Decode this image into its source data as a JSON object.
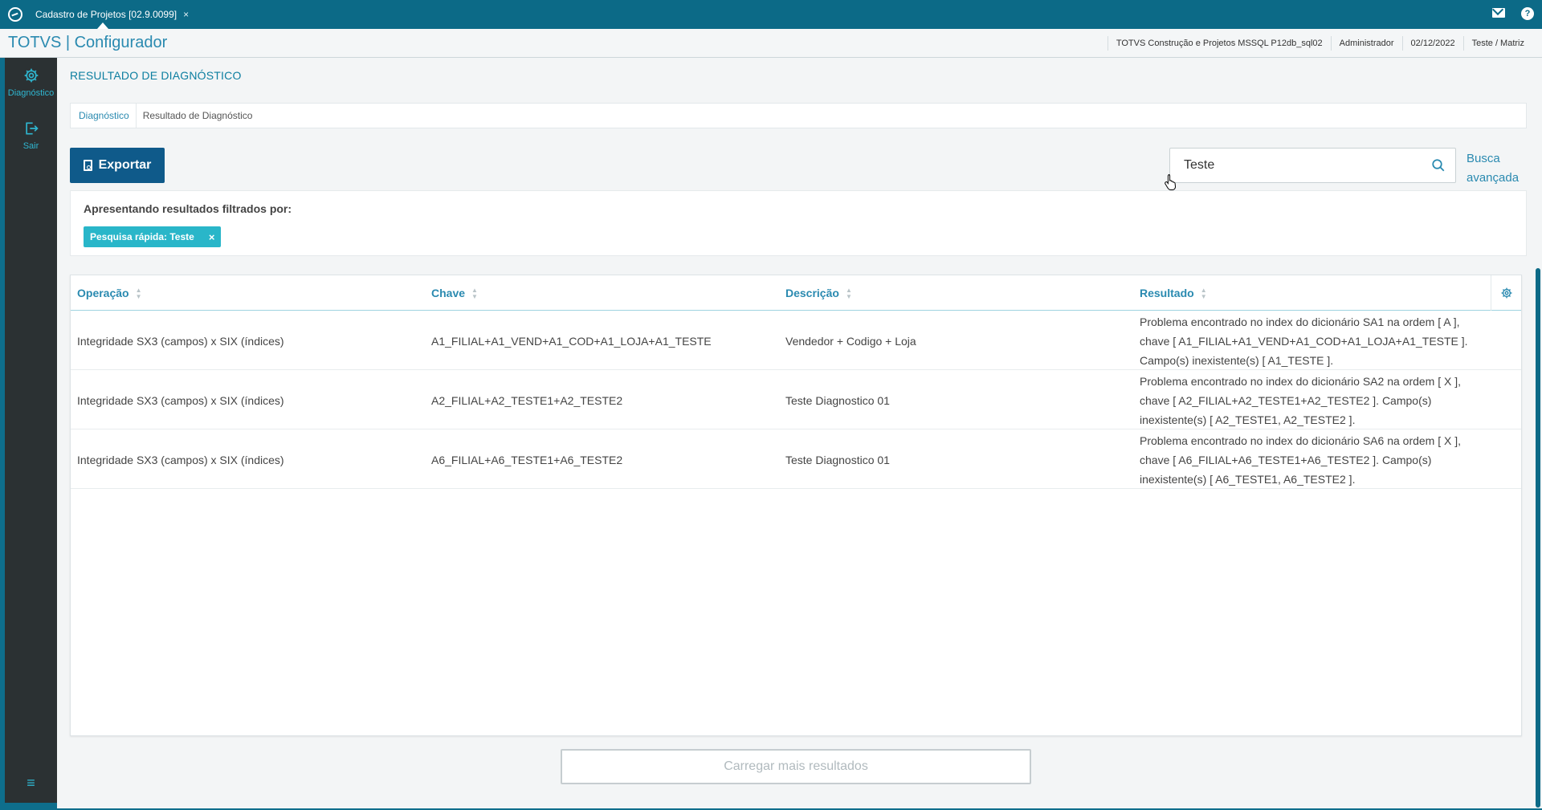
{
  "window": {
    "tab_title": "Cadastro de Projetos [02.9.0099]",
    "tab_close": "×",
    "help_symbol": "?"
  },
  "header": {
    "brand": "TOTVS | Configurador",
    "environment": "TOTVS Construção e Projetos MSSQL P12db_sql02",
    "user": "Administrador",
    "date": "02/12/2022",
    "branch": "Teste / Matriz"
  },
  "sidebar": {
    "items": [
      {
        "label": "Diagnóstico",
        "icon": "gear-icon"
      },
      {
        "label": "Sair",
        "icon": "logout-icon"
      }
    ],
    "menu_toggle_symbol": "≡"
  },
  "page": {
    "title": "RESULTADO DE DIAGNÓSTICO",
    "breadcrumb": [
      "Diagnóstico",
      "Resultado de Diagnóstico"
    ]
  },
  "toolbar": {
    "export_label": "Exportar",
    "search_value": "Teste",
    "advanced_search_line1": "Busca",
    "advanced_search_line2": "avançada"
  },
  "filters": {
    "label": "Apresentando resultados filtrados por:",
    "chips": [
      "Pesquisa rápida: Teste"
    ],
    "chip_close": "×"
  },
  "table": {
    "columns": [
      "Operação",
      "Chave",
      "Descrição",
      "Resultado"
    ],
    "rows": [
      {
        "operacao": "Integridade SX3 (campos) x SIX (índices)",
        "chave": "A1_FILIAL+A1_VEND+A1_COD+A1_LOJA+A1_TESTE",
        "descricao": "Vendedor + Codigo + Loja",
        "resultado": "Problema encontrado no index do dicionário SA1 na ordem [ A ], chave [ A1_FILIAL+A1_VEND+A1_COD+A1_LOJA+A1_TESTE ]. Campo(s) inexistente(s) [ A1_TESTE ]."
      },
      {
        "operacao": "Integridade SX3 (campos) x SIX (índices)",
        "chave": "A2_FILIAL+A2_TESTE1+A2_TESTE2",
        "descricao": "Teste Diagnostico 01",
        "resultado": "Problema encontrado no index do dicionário SA2 na ordem [ X ], chave [ A2_FILIAL+A2_TESTE1+A2_TESTE2 ]. Campo(s) inexistente(s) [ A2_TESTE1, A2_TESTE2 ]."
      },
      {
        "operacao": "Integridade SX3 (campos) x SIX (índices)",
        "chave": "A6_FILIAL+A6_TESTE1+A6_TESTE2",
        "descricao": "Teste Diagnostico 01",
        "resultado": "Problema encontrado no index do dicionário SA6 na ordem [ X ], chave [ A6_FILIAL+A6_TESTE1+A6_TESTE2 ]. Campo(s) inexistente(s) [ A6_TESTE1, A6_TESTE2 ]."
      }
    ]
  },
  "load_more_label": "Carregar mais resultados",
  "colors": {
    "topbar": "#0c6a87",
    "accent": "#2a8ab0",
    "primary_button": "#0f5a8a",
    "chip": "#29b6c9",
    "sidebar": "#2b3133"
  }
}
